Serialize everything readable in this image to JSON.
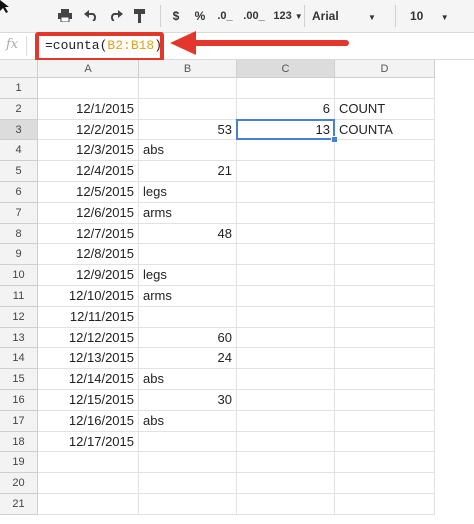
{
  "toolbar": {
    "buttons": [
      {
        "name": "print-icon"
      },
      {
        "name": "undo-icon"
      },
      {
        "name": "redo-icon"
      },
      {
        "name": "paint-format-icon"
      }
    ],
    "currency": "$",
    "percent": "%",
    "decrease_decimals": ".0_",
    "increase_decimals": ".00_",
    "more_formats": "123",
    "font": "Arial",
    "font_size": "10"
  },
  "formula_bar": {
    "fx_label": "fx",
    "formula_prefix": "=counta(",
    "formula_range": "B2:B18",
    "formula_suffix": ")"
  },
  "highlight_color": "#e2372a",
  "columns": [
    "A",
    "B",
    "C",
    "D"
  ],
  "rows": [
    {
      "n": "1",
      "a": "",
      "b": "",
      "c": "",
      "d": ""
    },
    {
      "n": "2",
      "a": "12/1/2015",
      "b": "",
      "c": "6",
      "d": "COUNT"
    },
    {
      "n": "3",
      "a": "12/2/2015",
      "b": "53",
      "c": "13",
      "d": "COUNTA"
    },
    {
      "n": "4",
      "a": "12/3/2015",
      "b": "abs",
      "c": "",
      "d": ""
    },
    {
      "n": "5",
      "a": "12/4/2015",
      "b": "21",
      "c": "",
      "d": ""
    },
    {
      "n": "6",
      "a": "12/5/2015",
      "b": "legs",
      "c": "",
      "d": ""
    },
    {
      "n": "7",
      "a": "12/6/2015",
      "b": "arms",
      "c": "",
      "d": ""
    },
    {
      "n": "8",
      "a": "12/7/2015",
      "b": "48",
      "c": "",
      "d": ""
    },
    {
      "n": "9",
      "a": "12/8/2015",
      "b": "",
      "c": "",
      "d": ""
    },
    {
      "n": "10",
      "a": "12/9/2015",
      "b": "legs",
      "c": "",
      "d": ""
    },
    {
      "n": "11",
      "a": "12/10/2015",
      "b": "arms",
      "c": "",
      "d": ""
    },
    {
      "n": "12",
      "a": "12/11/2015",
      "b": "",
      "c": "",
      "d": ""
    },
    {
      "n": "13",
      "a": "12/12/2015",
      "b": "60",
      "c": "",
      "d": ""
    },
    {
      "n": "14",
      "a": "12/13/2015",
      "b": "24",
      "c": "",
      "d": ""
    },
    {
      "n": "15",
      "a": "12/14/2015",
      "b": "abs",
      "c": "",
      "d": ""
    },
    {
      "n": "16",
      "a": "12/15/2015",
      "b": "30",
      "c": "",
      "d": ""
    },
    {
      "n": "17",
      "a": "12/16/2015",
      "b": "abs",
      "c": "",
      "d": ""
    },
    {
      "n": "18",
      "a": "12/17/2015",
      "b": "",
      "c": "",
      "d": ""
    },
    {
      "n": "19",
      "a": "",
      "b": "",
      "c": "",
      "d": ""
    },
    {
      "n": "20",
      "a": "",
      "b": "",
      "c": "",
      "d": ""
    },
    {
      "n": "21",
      "a": "",
      "b": "",
      "c": "",
      "d": ""
    }
  ],
  "selected_cell": "C3"
}
